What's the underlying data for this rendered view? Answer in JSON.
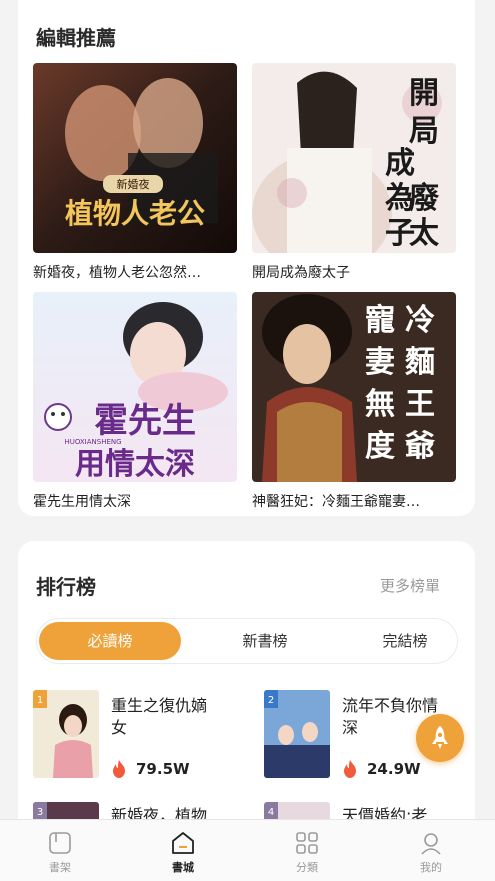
{
  "editor": {
    "title": "編輯推薦",
    "books": [
      {
        "title": "新婚夜，植物人老公忽然…",
        "cover_text": "植物人老公",
        "cover_badge": "新婚夜"
      },
      {
        "title": "開局成為廢太子",
        "cover_text": "開局成為廢太子"
      },
      {
        "title": "霍先生用情太深",
        "cover_text": "霍先生",
        "cover_text2": "用情太深",
        "cover_pinyin": "HUOXIANSHENG"
      },
      {
        "title": "神醫狂妃：冷麵王爺寵妻…",
        "cover_text": "冷麵王爺寵妻無度"
      }
    ]
  },
  "ranking": {
    "title": "排行榜",
    "more_label": "更多榜單",
    "tabs": [
      {
        "label": "必讀榜",
        "active": true
      },
      {
        "label": "新書榜",
        "active": false
      },
      {
        "label": "完結榜",
        "active": false
      }
    ],
    "items": [
      {
        "rank": "1",
        "title": "重生之復仇嫡女",
        "reads": "79.5W"
      },
      {
        "rank": "2",
        "title": "流年不負你情深",
        "reads": "24.9W"
      },
      {
        "rank": "3",
        "title": "新婚夜，植物",
        "reads": ""
      },
      {
        "rank": "4",
        "title": "天價婚約:老",
        "reads": ""
      }
    ]
  },
  "tabbar": {
    "items": [
      {
        "label": "書架",
        "icon": "bookshelf-icon",
        "active": false
      },
      {
        "label": "書城",
        "icon": "bookstore-icon",
        "active": true
      },
      {
        "label": "分類",
        "icon": "category-icon",
        "active": false
      },
      {
        "label": "我的",
        "icon": "profile-icon",
        "active": false
      }
    ]
  },
  "colors": {
    "accent": "#f0a23a",
    "fire": "#f25a3c"
  }
}
